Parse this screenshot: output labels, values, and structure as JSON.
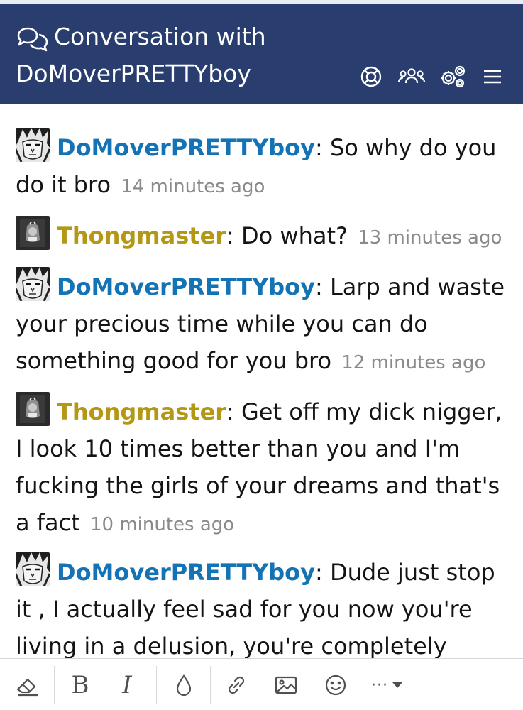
{
  "header": {
    "title_prefix": "Conversation with",
    "title_name": "DoMoverPRETTYboy",
    "icons": [
      "lifebuoy-icon",
      "users-icon",
      "gears-icon",
      "menu-icon"
    ]
  },
  "messages": [
    {
      "user": "DoMoverPRETTYboy",
      "separator": ":",
      "text": " So why do you do it bro",
      "time": "14 minutes ago",
      "avatar": "manga-face-avatar"
    },
    {
      "user": "Thongmaster",
      "separator": ":",
      "text": " Do what?",
      "time": "13 minutes ago",
      "avatar": "dark-photo-avatar"
    },
    {
      "user": "DoMoverPRETTYboy",
      "separator": ":",
      "text": " Larp and waste your precious time while you can do something good for you bro",
      "time": "12 minutes ago",
      "avatar": "manga-face-avatar"
    },
    {
      "user": "Thongmaster",
      "separator": ":",
      "text": " Get off my dick nigger, I look 10 times better than you and I'm fucking the girls of your dreams and that's a fact",
      "time": "10 minutes ago",
      "avatar": "dark-photo-avatar"
    },
    {
      "user": "DoMoverPRETTYboy",
      "separator": ":",
      "text": " Dude just stop it , I actually feel sad for you now you're living in a delusion, you're completely",
      "time": "",
      "avatar": "manga-face-avatar"
    }
  ],
  "toolbar": {
    "bold_label": "B",
    "italic_label": "I",
    "more_label": "···"
  },
  "colors": {
    "header_bg": "#293d6f",
    "username_blue": "#1473b5",
    "username_gold": "#b39715",
    "timestamp": "#8a8a8a"
  }
}
